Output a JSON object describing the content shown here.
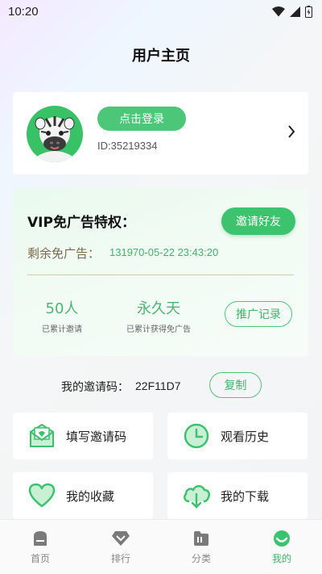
{
  "status": {
    "time": "10:20"
  },
  "header": {
    "title": "用户主页"
  },
  "profile": {
    "login_label": "点击登录",
    "user_id": "ID:35219334"
  },
  "vip": {
    "title": "VIP免广告特权：",
    "invite_label": "邀请好友",
    "remain_label": "剩余免广告：",
    "remain_value": "131970-05-22 23:43:20",
    "invited_value": "50人",
    "invited_label": "已累计邀请",
    "earned_value": "永久天",
    "earned_label": "已累计获得免广告",
    "record_label": "推广记录"
  },
  "invite_code": {
    "label": "我的邀请码：",
    "value": "22F11D7",
    "copy_label": "复制"
  },
  "menu": [
    {
      "label": "填写邀请码",
      "icon": "invite-envelope-icon"
    },
    {
      "label": "观看历史",
      "icon": "clock-icon"
    },
    {
      "label": "我的收藏",
      "icon": "heart-icon"
    },
    {
      "label": "我的下载",
      "icon": "cloud-download-icon"
    }
  ],
  "tabs": [
    {
      "label": "首页",
      "icon": "home-icon"
    },
    {
      "label": "排行",
      "icon": "diamond-icon"
    },
    {
      "label": "分类",
      "icon": "folder-icon"
    },
    {
      "label": "我的",
      "icon": "profile-icon",
      "active": true
    }
  ],
  "colors": {
    "accent": "#4cc679",
    "text_gold": "#7a6a4a"
  }
}
